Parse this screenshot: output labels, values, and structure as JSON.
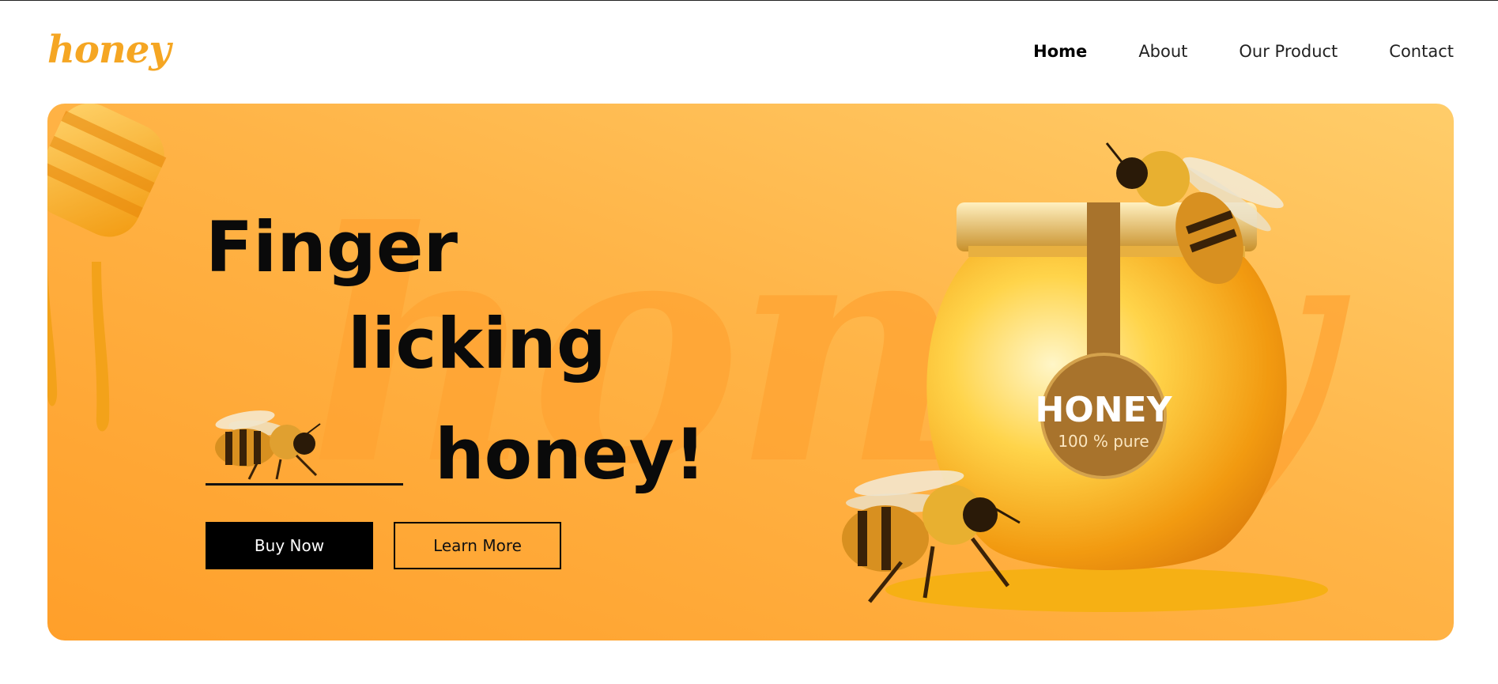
{
  "brand": {
    "logo_text": "honey"
  },
  "nav": {
    "items": [
      {
        "label": "Home",
        "active": true
      },
      {
        "label": "About",
        "active": false
      },
      {
        "label": "Our Product",
        "active": false
      },
      {
        "label": "Contact",
        "active": false
      }
    ]
  },
  "hero": {
    "watermark": "honey",
    "headline": {
      "line1": "Finger",
      "line2": "licking",
      "line3": "honey!"
    },
    "buttons": {
      "buy_label": "Buy Now",
      "learn_label": "Learn More"
    },
    "jar_label": {
      "title": "HONEY",
      "subtitle": "100 % pure"
    }
  },
  "colors": {
    "accent": "#f5a623",
    "hero_bg": "#ffb447",
    "text": "#0a0a0a"
  }
}
